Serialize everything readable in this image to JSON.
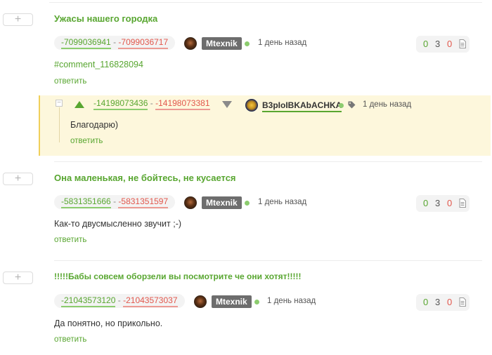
{
  "expand_symbol": "+",
  "collapse_symbol": "−",
  "reply_label": "ответить",
  "comments": [
    {
      "title": "Ужасы нашего городка",
      "rating_up": "-7099036941",
      "rating_sep": " - ",
      "rating_down": "-7099036717",
      "user": "Mtexnik",
      "time": "1 день назад",
      "stats": {
        "up": "0",
        "mid": "3",
        "down": "0"
      },
      "link_text": "#comment_116828094"
    },
    {
      "title": "Она маленькая, не бойтесь, не кусается",
      "rating_up": "-5831351666",
      "rating_sep": " - ",
      "rating_down": "-5831351597",
      "user": "Mtexnik",
      "time": "1 день назад",
      "stats": {
        "up": "0",
        "mid": "3",
        "down": "0"
      },
      "text": "Как-то двусмысленно звучит ;-)"
    },
    {
      "title": "!!!!!Бабы совсем оборзели вы посмотрите че они хотят!!!!!",
      "rating_up": "-21043573120",
      "rating_sep": " - ",
      "rating_down": "-21043573037",
      "user": "Mtexnik",
      "time": "1 день назад",
      "stats": {
        "up": "0",
        "mid": "3",
        "down": "0"
      },
      "text": "Да понятно, но прикольно."
    }
  ],
  "reply": {
    "rating_up": "-14198073436",
    "rating_sep": " - ",
    "rating_down": "-14198073381",
    "user": "B3pIoIBKAbACHKA",
    "time": "1 день назад",
    "text": "Благодарю)"
  },
  "colors": {
    "accent_green": "#58a630",
    "negative_red": "#e2574c",
    "reply_background": "#fdf7dc",
    "reply_border": "#f0cf5a",
    "user_badge": "#6d6d6d"
  },
  "icons": [
    "plus-icon",
    "avatar-icon",
    "online-dot-icon",
    "document-icon",
    "tag-icon",
    "arrow-up-icon",
    "arrow-down-icon",
    "collapse-icon"
  ]
}
